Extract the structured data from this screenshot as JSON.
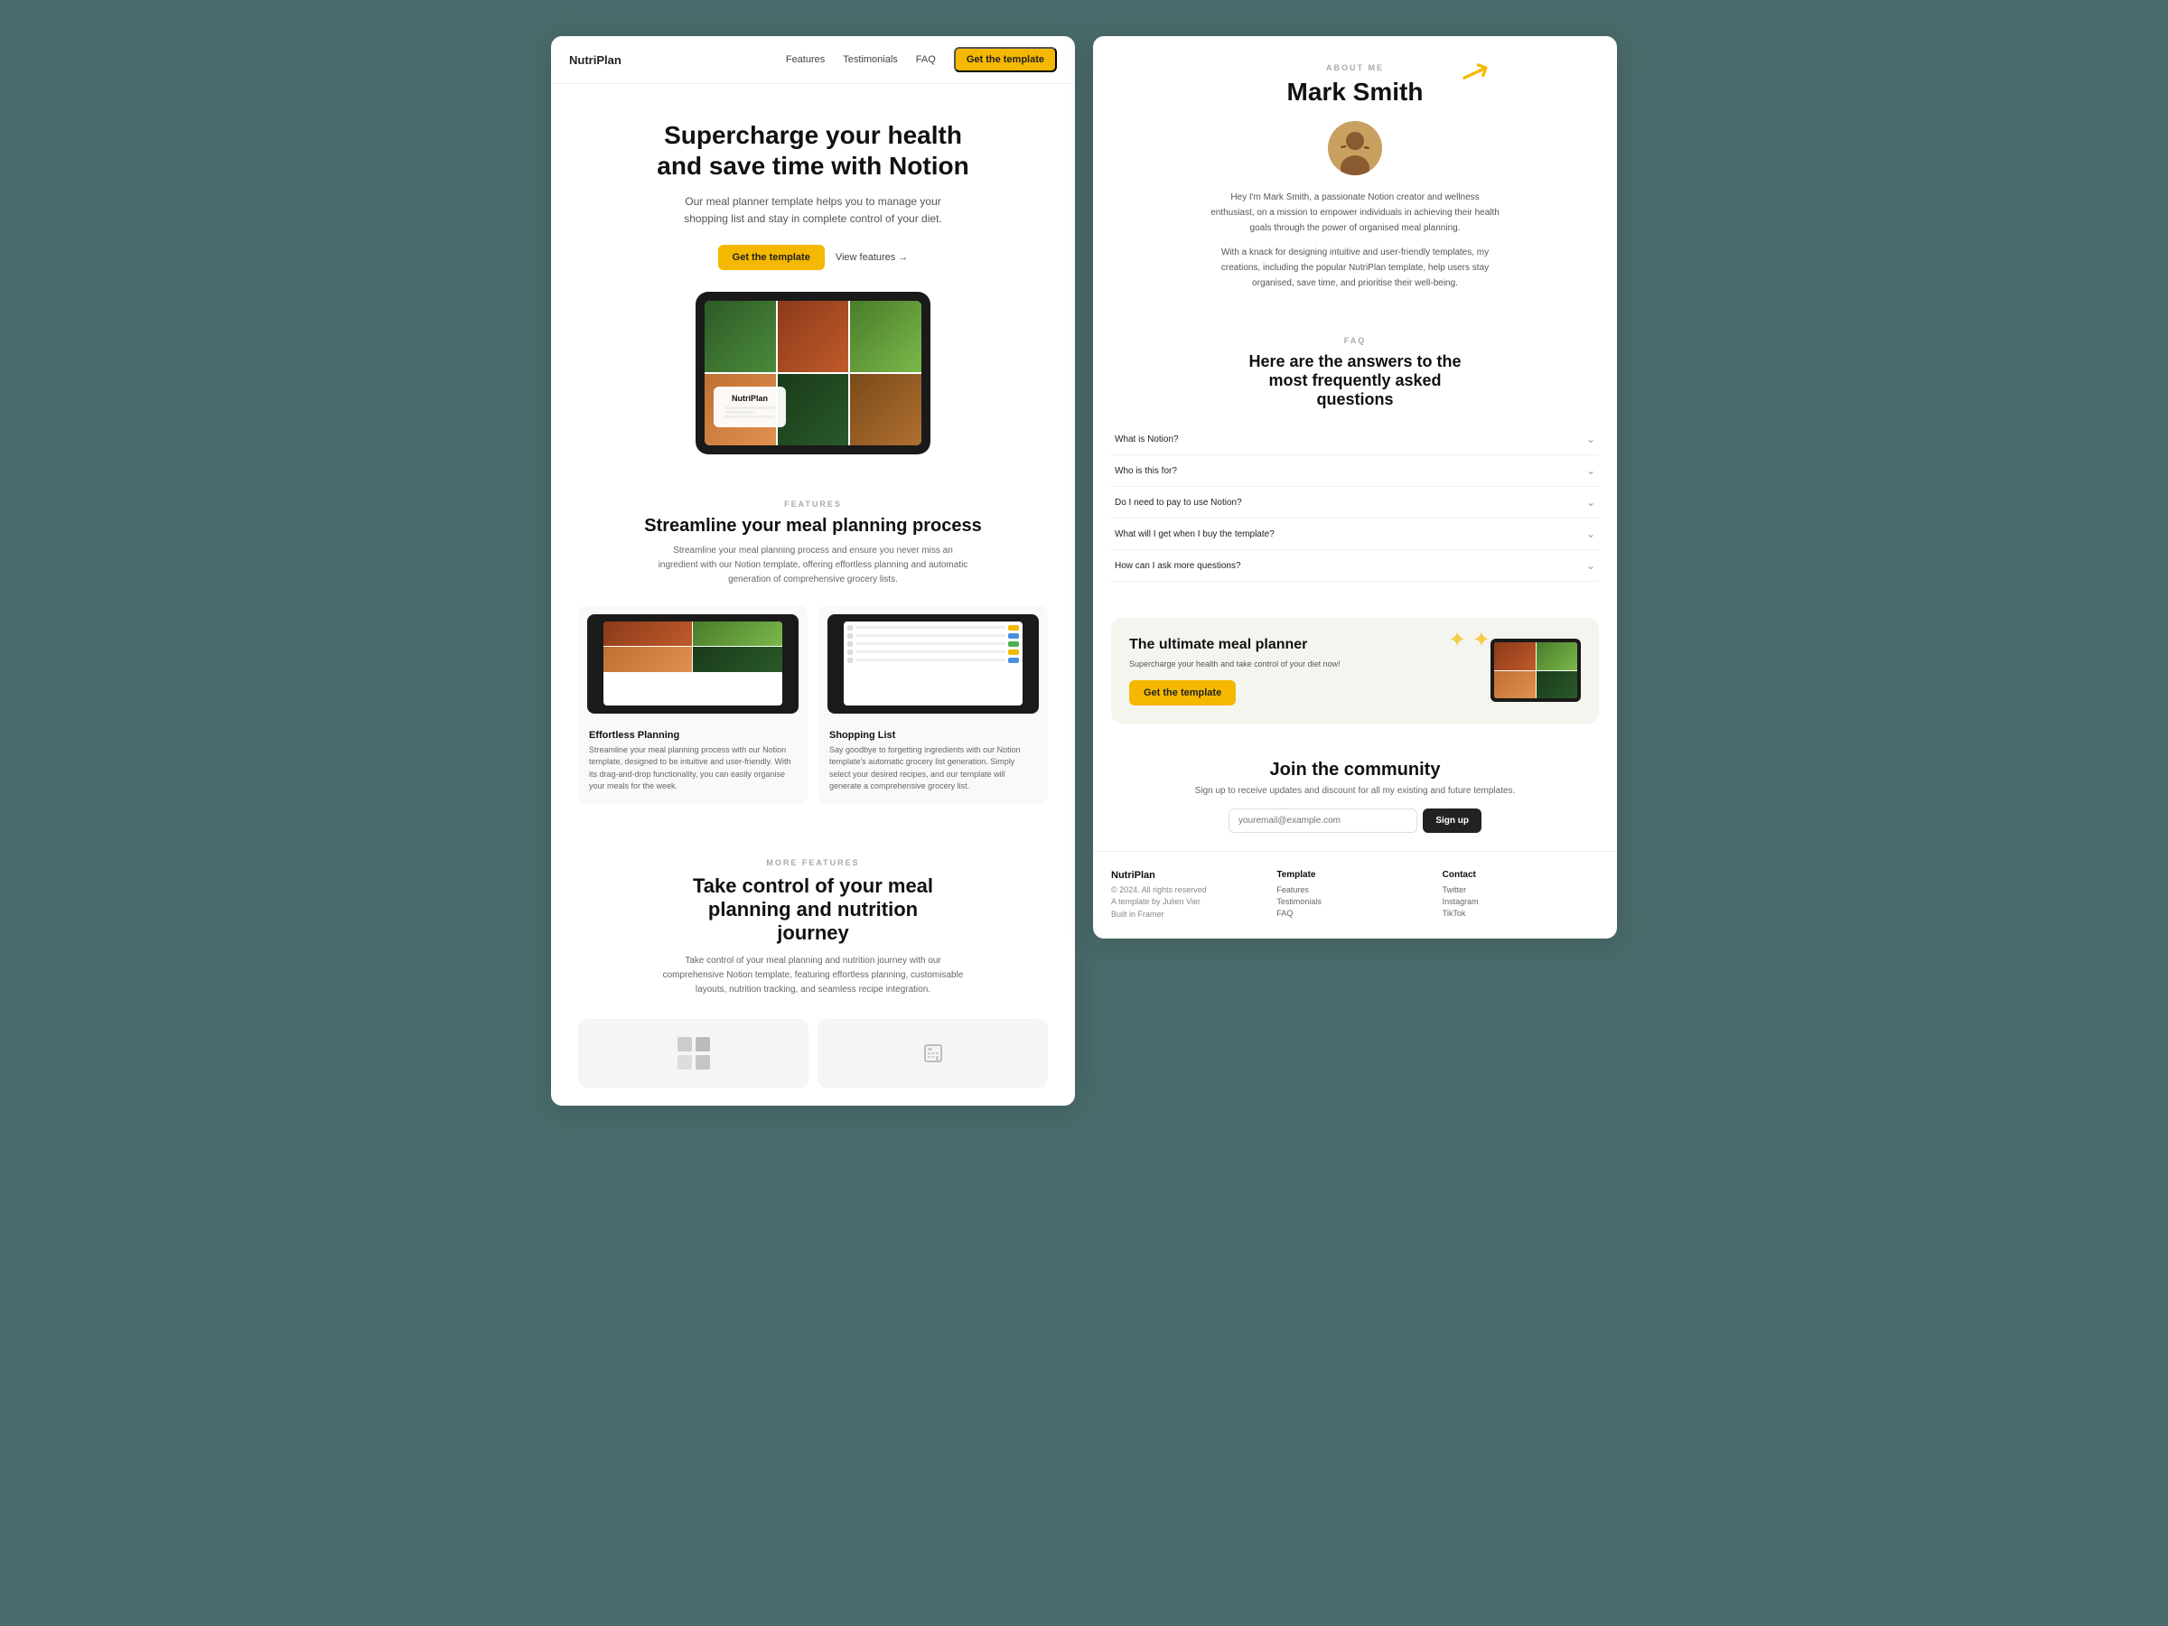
{
  "left": {
    "nav": {
      "logo": "NutriPlan",
      "links": [
        "Features",
        "Testimonials",
        "FAQ"
      ],
      "cta": "Get the template"
    },
    "hero": {
      "title_line1": "Supercharge your health",
      "title_line2": "and save time with Notion",
      "subtitle": "Our meal planner template helps you to manage your shopping list and stay in complete control of your diet.",
      "btn_primary": "Get the template",
      "btn_link": "View features →"
    },
    "features_section": {
      "label": "FEATURES",
      "title": "Streamline your meal planning process",
      "subtitle": "Streamline your meal planning process and ensure you never miss an ingredient with our Notion template, offering effortless planning and automatic generation of comprehensive grocery lists.",
      "cards": [
        {
          "title": "Effortless Planning",
          "text": "Streamline your meal planning process with our Notion template, designed to be intuitive and user-friendly. With its drag-and-drop functionality, you can easily organise your meals for the week."
        },
        {
          "title": "Shopping List",
          "text": "Say goodbye to forgetting ingredients with our Notion template's automatic grocery list generation. Simply select your desired recipes, and our template will generate a comprehensive grocery list."
        }
      ]
    },
    "more_features": {
      "label": "MORE FEATURES",
      "title": "Take control of your meal planning and nutrition journey",
      "text": "Take control of your meal planning and nutrition journey with our comprehensive Notion template, featuring effortless planning, customisable layouts, nutrition tracking, and seamless recipe integration."
    }
  },
  "right": {
    "about": {
      "label": "ABOUT ME",
      "name": "Mark Smith",
      "bio1": "Hey I'm Mark Smith, a passionate Notion creator and wellness enthusiast, on a mission to empower individuals in achieving their health goals through the power of organised meal planning.",
      "bio2": "With a knack for designing intuitive and user-friendly templates, my creations, including the popular NutriPlan template, help users stay organised, save time, and prioritise their well-being."
    },
    "faq": {
      "label": "FAQ",
      "title": "Here are the answers to the most frequently asked questions",
      "items": [
        {
          "question": "What is Notion?"
        },
        {
          "question": "Who is this for?"
        },
        {
          "question": "Do I need to pay to use Notion?"
        },
        {
          "question": "What will I get when I buy the template?"
        },
        {
          "question": "How can I ask more questions?"
        }
      ]
    },
    "cta_box": {
      "title": "The ultimate meal planner",
      "text": "Supercharge your health and take control of your diet now!",
      "btn": "Get the template"
    },
    "community": {
      "title": "Join the community",
      "text": "Sign up to receive updates and discount for all my existing and future templates.",
      "email_placeholder": "youremail@example.com",
      "signup_btn": "Sign up"
    },
    "footer": {
      "brand": {
        "name": "NutriPlan",
        "copy": "© 2024. All rights reserved",
        "credit": "A template by Julien Vier",
        "built": "Built in Framer"
      },
      "template_col": {
        "title": "Template",
        "links": [
          "Features",
          "Testimonials",
          "FAQ"
        ]
      },
      "contact_col": {
        "title": "Contact",
        "links": [
          "Twitter",
          "Instagram",
          "TikTok"
        ]
      }
    }
  }
}
